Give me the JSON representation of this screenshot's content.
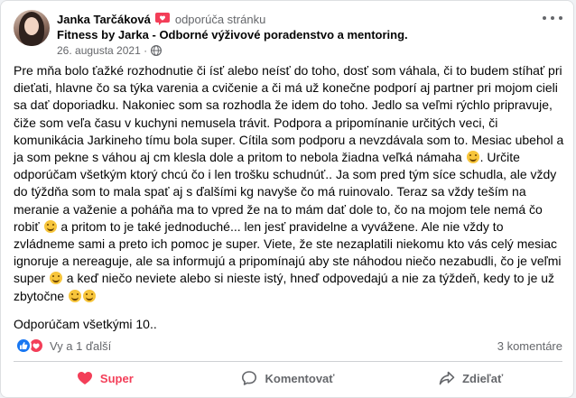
{
  "post": {
    "author": "Janka Tarčáková",
    "recommends": "odporúča stránku",
    "page": "Fitness by Jarka - Odborné výživové poradenstvo a mentoring.",
    "date": "26. augusta 2021 ·",
    "paragraph1_a": "Pre mňa bolo ťažké rozhodnutie či ísť alebo neísť do toho, dosť som váhala, či to budem stíhať pri dieťati, hlavne čo sa týka varenia a cvičenie a či má už konečne podporí aj partner pri mojom cieli sa dať doporiadku. Nakoniec som sa rozhodla že idem do toho. Jedlo sa veľmi rýchlo pripravuje, čiže som veľa času v kuchyni nemusela trávit. Podpora a pripomínanie určitých veci, či komunikácia Jarkineho tímu bola super. Cítila som podporu a nevzdávala som to. Mesiac ubehol a ja som pekne s váhou aj cm klesla dole a pritom to nebola žiadna veľká námaha",
    "paragraph1_b": ". Určite odporúčam všetkým ktorý chcú čo i len trošku schudnúť.. Ja som pred tým síce schudla, ale vždy do týždňa som to mala spať aj s ďalšími kg navyše čo má ruinovalo. Teraz sa vždy teším na meranie a važenie a poháňa ma to vpred že na to mám dať dole to, čo  na mojom tele nemá čo robiť",
    "paragraph1_c": " a pritom to je také jednoduché... len jesť pravidelne a vyvážene. Ale nie vždy to zvládneme sami a preto ich pomoc je super. Viete, že ste nezaplatili niekomu kto vás celý mesiac ignoruje a nereaguje, ale sa informujú a pripomínajú aby ste náhodou niečo nezabudli, čo je veľmi super",
    "paragraph1_d": " a keď niečo neviete alebo si nieste istý, hneď odpovedajú a nie za týždeň, kedy to je už zbytočne",
    "paragraph2": "Odporúčam všetkými 10.."
  },
  "reactions": {
    "text": "Vy a 1 ďalší",
    "comments": "3 komentáre"
  },
  "actions": {
    "like": "Super",
    "comment": "Komentovať",
    "share": "Zdieľať"
  },
  "colors": {
    "love": "#f33e58",
    "like": "#1877f2",
    "muted": "#65676b"
  }
}
